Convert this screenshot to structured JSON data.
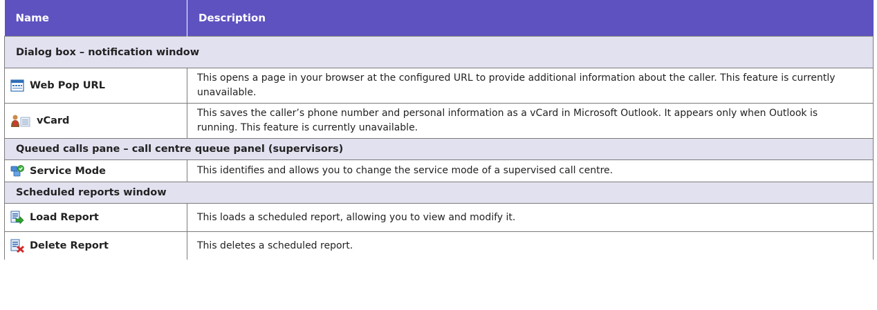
{
  "header": {
    "col_name": "Name",
    "col_description": "Description"
  },
  "sections": [
    {
      "title": "Dialog box – notification window",
      "items": [
        {
          "name": "Web Pop URL",
          "icon": "web-page-icon",
          "description": "This opens a page in your browser at the configured URL to provide additional information about the caller. This feature is currently unavailable."
        },
        {
          "name": "vCard",
          "icon": "contact-card-icon",
          "description": "This saves the caller’s phone number and personal information as a vCard in Microsoft Outlook. It appears only when Outlook is running. This feature is currently unavailable."
        }
      ]
    },
    {
      "title": "Queued calls pane – call centre queue panel (supervisors)",
      "items": [
        {
          "name": "Service Mode",
          "icon": "service-mode-icon",
          "description": "This identifies and allows you to change the service mode of a supervised call centre."
        }
      ]
    },
    {
      "title": "Scheduled reports window",
      "items": [
        {
          "name": "Load Report",
          "icon": "load-report-icon",
          "description": "This loads a scheduled report, allowing you to view and modify it."
        },
        {
          "name": "Delete Report",
          "icon": "delete-report-icon",
          "description": "This deletes a scheduled report."
        }
      ]
    }
  ]
}
